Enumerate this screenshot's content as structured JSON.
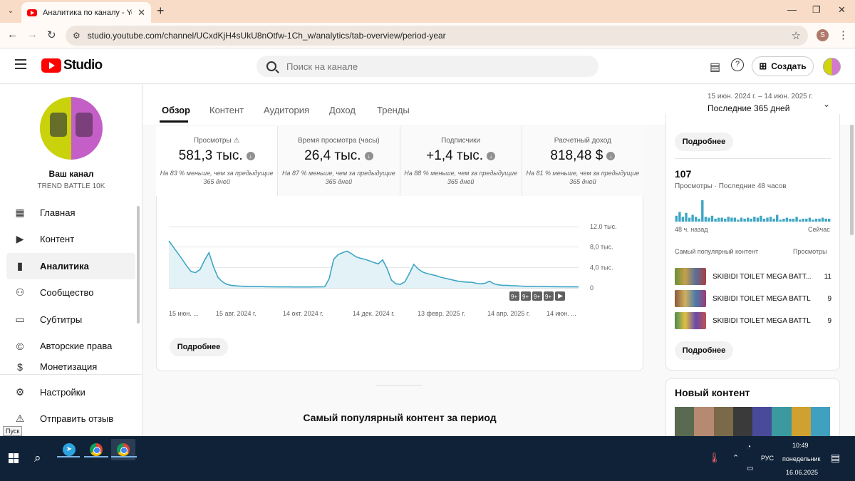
{
  "browser": {
    "tab_title": "Аналитика по каналу - YouTube",
    "url": "studio.youtube.com/channel/UCxdKjH4sUkU8nOtfw-1Ch_w/analytics/tab-overview/period-year",
    "profile_initial": "S"
  },
  "header": {
    "logo_text": "Studio",
    "search_placeholder": "Поиск на канале",
    "create_label": "Создать"
  },
  "sidebar": {
    "channel_name": "Ваш канал",
    "channel_handle": "TREND BATTLE 10K",
    "items": [
      {
        "label": "Главная",
        "icon": "dashboard-icon"
      },
      {
        "label": "Контент",
        "icon": "content-icon"
      },
      {
        "label": "Аналитика",
        "icon": "analytics-icon"
      },
      {
        "label": "Сообщество",
        "icon": "community-icon"
      },
      {
        "label": "Субтитры",
        "icon": "subtitles-icon"
      },
      {
        "label": "Авторские права",
        "icon": "copyright-icon"
      },
      {
        "label": "Монетизация",
        "icon": "monetization-icon"
      }
    ],
    "bottom_items": [
      {
        "label": "Настройки",
        "icon": "settings-icon"
      },
      {
        "label": "Отправить отзыв",
        "icon": "feedback-icon"
      }
    ]
  },
  "tabs": [
    "Обзор",
    "Контент",
    "Аудитория",
    "Доход",
    "Тренды"
  ],
  "period": {
    "range": "15 июн. 2024 г. – 14 июн. 2025 г.",
    "label": "Последние 365 дней"
  },
  "metrics": [
    {
      "label": "Просмотры",
      "value": "581,3 тыс.",
      "note": "На 83 % меньше, чем за предыдущие 365 дней"
    },
    {
      "label": "Время просмотра (часы)",
      "value": "26,4 тыс.",
      "note": "На 87 % меньше, чем за предыдущие 365 дней"
    },
    {
      "label": "Подписчики",
      "value": "+1,4 тыс.",
      "note": "На 88 % меньше, чем за предыдущие 365 дней"
    },
    {
      "label": "Расчетный доход",
      "value": "818,48 $",
      "note": "На 81 % меньше, чем за предыдущие 365 дней"
    }
  ],
  "more_button": "Подробнее",
  "chart_data": {
    "type": "area",
    "y_ticks": [
      "12,0 тыс.",
      "8,0 тыс.",
      "4,0 тыс.",
      "0"
    ],
    "ylim": [
      0,
      12000
    ],
    "x_ticks": [
      "15 июн. ...",
      "15 авг. 2024 г.",
      "14 окт. 2024 г.",
      "14 дек. 2024 г.",
      "13 февр. 2025 г.",
      "14 апр. 2025 г.",
      "14 июн. ..."
    ],
    "series": [
      {
        "values": [
          9200,
          8000,
          6800,
          5600,
          4300,
          3200,
          3000,
          3600,
          5400,
          6900,
          4200,
          2100,
          1200,
          700,
          500,
          400,
          350,
          300,
          300,
          250,
          250,
          250,
          220,
          220,
          200,
          200,
          200,
          200,
          180,
          180,
          180,
          180,
          180,
          190,
          200,
          230,
          1800,
          5600,
          6500,
          6900,
          7200,
          6700,
          6100,
          5800,
          5600,
          5300,
          5000,
          4700,
          5500,
          3800,
          1500,
          800,
          700,
          1200,
          2800,
          4600,
          3700,
          3100,
          2800,
          2600,
          2400,
          2100,
          1900,
          1700,
          1500,
          1300,
          1200,
          1100,
          1100,
          900,
          800,
          900,
          1300,
          800,
          600,
          500,
          500,
          420,
          400,
          350,
          300,
          300,
          300,
          280,
          260,
          250,
          240,
          240,
          230,
          230,
          220,
          220,
          200
        ]
      }
    ],
    "badges": [
      "9+",
      "9+",
      "9+",
      "9+"
    ],
    "color": "#3ea6c4"
  },
  "section_title": "Самый популярный контент за период",
  "realtime": {
    "count": "107",
    "subtitle": "Просмотры · Последние 48 часов",
    "left_axis": "48 ч. назад",
    "right_axis": "Сейчас",
    "bars": [
      6,
      10,
      5,
      9,
      4,
      7,
      5,
      3,
      22,
      5,
      4,
      6,
      3,
      4,
      4,
      3,
      5,
      4,
      4,
      2,
      4,
      3,
      4,
      3,
      5,
      4,
      6,
      3,
      4,
      5,
      3,
      7,
      2,
      3,
      4,
      3,
      3,
      5,
      2,
      3,
      3,
      4,
      2,
      3,
      3,
      4,
      3,
      3
    ],
    "popular_header": "Самый популярный контент",
    "popular_col": "Просмотры",
    "videos": [
      {
        "title": "SKIBIDI TOILET MEGA BATT...",
        "views": "11"
      },
      {
        "title": "SKIBIDI TOILET MEGA BATTLE",
        "views": "9"
      },
      {
        "title": "SKIBIDI TOILET MEGA BATTL...",
        "views": "9"
      }
    ]
  },
  "new_content_title": "Новый контент",
  "taskbar": {
    "tooltip": "Пуск",
    "lang": "РУС",
    "time": "10:49",
    "day": "понедельник",
    "date": "16.06.2025"
  }
}
